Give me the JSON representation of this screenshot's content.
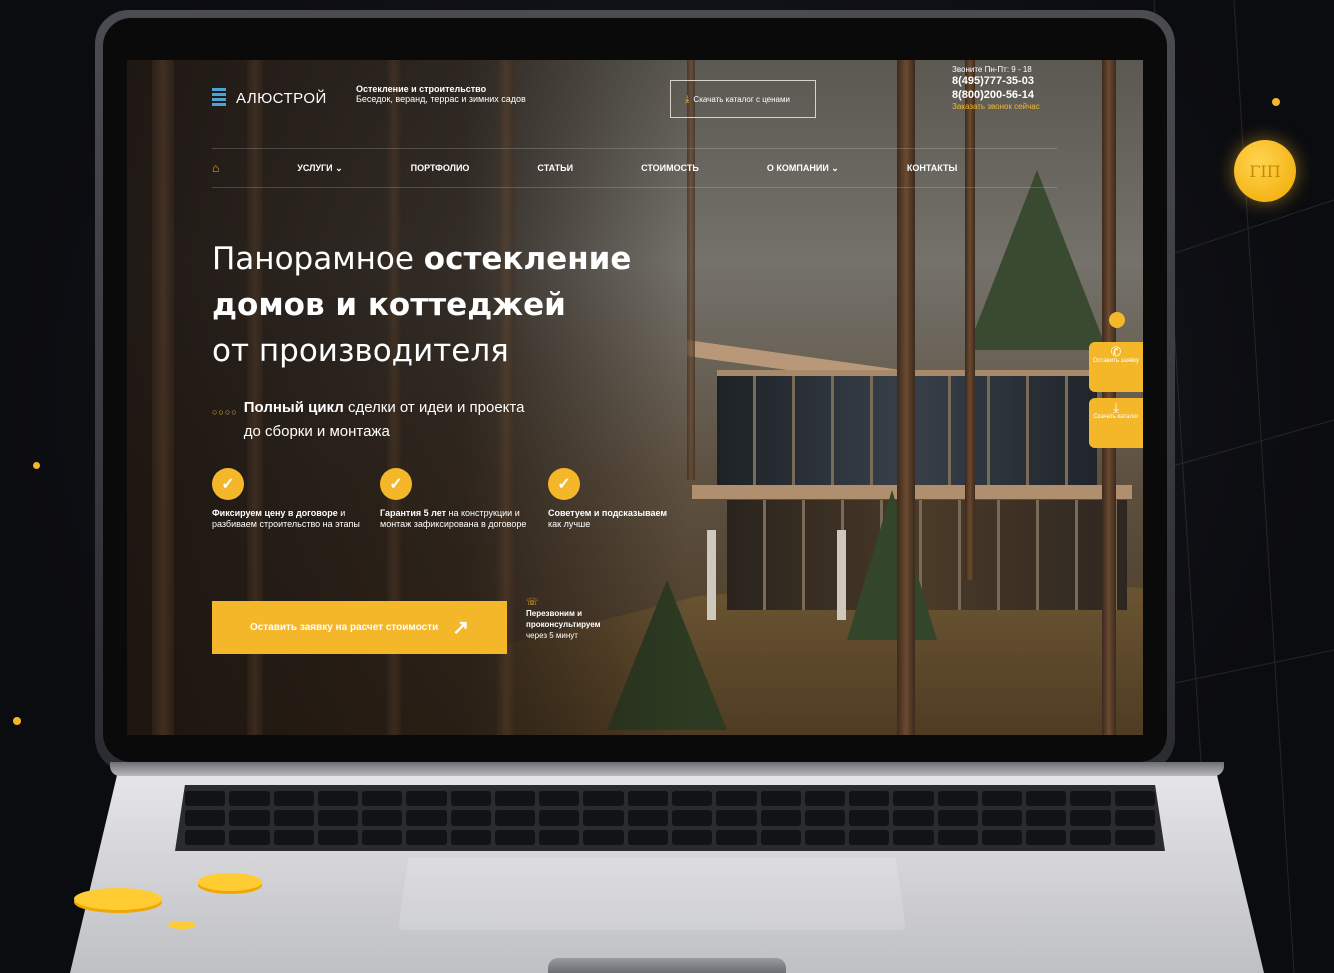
{
  "site": {
    "logo_text": "АЛЮСТРОЙ",
    "tagline_bold": "Остекление и строительство",
    "tagline_rest": "Беседок, веранд, террас и зимних садов",
    "catalog_button": "Скачать каталог с ценами",
    "contacts": {
      "hours": "Звоните Пн-Пт: 9 - 18",
      "phone1": "8(495)777-35-03",
      "phone2": "8(800)200-56-14",
      "callback": "Заказать звонок сейчас"
    },
    "nav": {
      "home_icon": "home-icon",
      "items": [
        "Услуги",
        "Портфолио",
        "Статьи",
        "Стоимость",
        "О компании",
        "Контакты"
      ]
    },
    "hero": {
      "title_line1_light": "Панорамное ",
      "title_line1_bold": "остекление",
      "title_line2_bold": "домов и коттеджей",
      "title_line3_light": "от производителя",
      "lead_bold": "Полный цикл",
      "lead_rest1": " сделки от идеи и проекта",
      "lead_rest2": "до сборки и монтажа"
    },
    "features": [
      {
        "bold": "Фиксируем цену в договоре",
        "rest": " и разбиваем строительство на этапы"
      },
      {
        "bold": "Гарантия 5 лет",
        "rest": " на конструкции и монтаж зафиксирована в договоре"
      },
      {
        "bold": "Советуем и подсказываем",
        "rest": " как лучше"
      }
    ],
    "cta_label": "Оставить заявку на расчет стоимости",
    "callnote": {
      "bold": "Перезвоним и проконсультируем",
      "rest": "через 5 минут"
    },
    "side_buttons": [
      {
        "icon": "phone-icon",
        "label": "Оставить заявку"
      },
      {
        "icon": "download-icon",
        "label": "Скачать каталог"
      }
    ]
  },
  "colors": {
    "accent": "#f5b72a",
    "logo_blue": "#4aa3d9"
  }
}
